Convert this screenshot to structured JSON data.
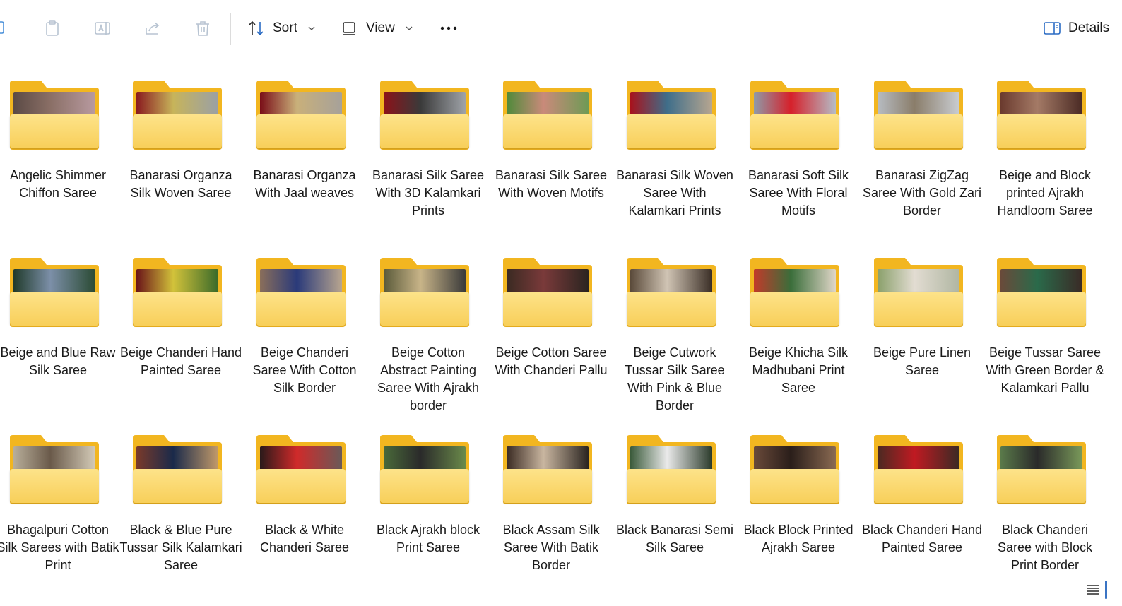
{
  "toolbar": {
    "sort_label": "Sort",
    "view_label": "View",
    "details_label": "Details",
    "icons": [
      "copy-icon",
      "paste-icon",
      "rename-icon",
      "share-icon",
      "delete-icon",
      "sort-icon",
      "view-icon",
      "more-icon",
      "details-pane-icon"
    ]
  },
  "folders": [
    {
      "name": "Angelic Shimmer Chiffon Saree",
      "thumb": [
        "#5b4a45",
        "#8a6f66",
        "#b89aa0"
      ]
    },
    {
      "name": "Banarasi Organza Silk Woven Saree",
      "thumb": [
        "#8a1a1f",
        "#c7b45a",
        "#9aa0a5"
      ]
    },
    {
      "name": "Banarasi Organza With Jaal weaves",
      "thumb": [
        "#7a0e18",
        "#c9b07a",
        "#a6a19a"
      ]
    },
    {
      "name": "Banarasi Silk Saree With 3D Kalamkari Prints",
      "thumb": [
        "#8c1219",
        "#3a3a3a",
        "#9fa3a8"
      ]
    },
    {
      "name": "Banarasi Silk Saree With Woven Motifs",
      "thumb": [
        "#4f8a3a",
        "#c98a7a",
        "#6e9a55"
      ]
    },
    {
      "name": "Banarasi Silk Woven Saree With Kalamkari Prints",
      "thumb": [
        "#a8121c",
        "#3f6e8a",
        "#b7a690"
      ]
    },
    {
      "name": "Banarasi Soft Silk Saree With Floral Motifs",
      "thumb": [
        "#8f9aa8",
        "#d6202a",
        "#b5bcc6"
      ]
    },
    {
      "name": "Banarasi ZigZag Saree With Gold Zari Border",
      "thumb": [
        "#b7bcc2",
        "#8a7d6a",
        "#c9cdd2"
      ]
    },
    {
      "name": "Beige and Block printed Ajrakh Handloom Saree",
      "thumb": [
        "#6a3a2e",
        "#a47a66",
        "#4a2a24"
      ]
    },
    {
      "name": "Beige and Blue Raw Silk Saree",
      "thumb": [
        "#1f3a2a",
        "#7c8fa8",
        "#2a4a33"
      ]
    },
    {
      "name": "Beige Chanderi Hand Painted Saree",
      "thumb": [
        "#6a1418",
        "#d2c23a",
        "#3a6a2a"
      ]
    },
    {
      "name": "Beige Chanderi Saree With Cotton Silk Border",
      "thumb": [
        "#8a6e5a",
        "#2a3a7a",
        "#b8a58f"
      ]
    },
    {
      "name": "Beige Cotton Abstract Painting Saree With Ajrakh border",
      "thumb": [
        "#5a5a3a",
        "#c8b488",
        "#3a3a3a"
      ]
    },
    {
      "name": "Beige Cotton Saree With Chanderi Pallu",
      "thumb": [
        "#3a2a22",
        "#7a3a3a",
        "#2a2420"
      ]
    },
    {
      "name": "Beige Cutwork Tussar Silk Saree With Pink & Blue Border",
      "thumb": [
        "#5a4a3a",
        "#d0c4b4",
        "#3a2e26"
      ]
    },
    {
      "name": "Beige Khicha Silk Madhubani Print Saree",
      "thumb": [
        "#c23a2a",
        "#3a6e3a",
        "#e0d6c8"
      ]
    },
    {
      "name": "Beige Pure Linen Saree",
      "thumb": [
        "#8aa06a",
        "#e2dcd2",
        "#b0b6a2"
      ]
    },
    {
      "name": "Beige Tussar Saree With Green Border & Kalamkari Pallu",
      "thumb": [
        "#6a4a3a",
        "#2a6a4a",
        "#3a2a26"
      ]
    },
    {
      "name": "Bhagalpuri Cotton Silk Sarees with Batik Print",
      "thumb": [
        "#b8ae9a",
        "#6a5a4a",
        "#d4cbb8"
      ]
    },
    {
      "name": "Black & Blue Pure Tussar Silk Kalamkari Saree",
      "thumb": [
        "#7a3a2a",
        "#1a2a4a",
        "#c29a6a"
      ]
    },
    {
      "name": "Black & White Chanderi Saree",
      "thumb": [
        "#2a1a1a",
        "#d02a2a",
        "#6a5a58"
      ]
    },
    {
      "name": "Black Ajrakh block Print Saree",
      "thumb": [
        "#4a6a3a",
        "#2a2a2a",
        "#6a8a4a"
      ]
    },
    {
      "name": "Black Assam Silk Saree With Batik Border",
      "thumb": [
        "#3a2a22",
        "#c9b6a0",
        "#2a2420"
      ]
    },
    {
      "name": "Black Banarasi Semi Silk Saree",
      "thumb": [
        "#3a5a3a",
        "#eaeaea",
        "#2a3a2a"
      ]
    },
    {
      "name": "Black Block Printed Ajrakh Saree",
      "thumb": [
        "#6a4a3a",
        "#2a1e1a",
        "#8a6a52"
      ]
    },
    {
      "name": "Black Chanderi Hand Painted Saree",
      "thumb": [
        "#4a2a22",
        "#c01a22",
        "#3a2a24"
      ]
    },
    {
      "name": "Black Chanderi Saree with Block Print Border",
      "thumb": [
        "#5a7a4a",
        "#2a2a2a",
        "#7a9a5a"
      ]
    }
  ],
  "status_view_icon": "list-view-icon"
}
